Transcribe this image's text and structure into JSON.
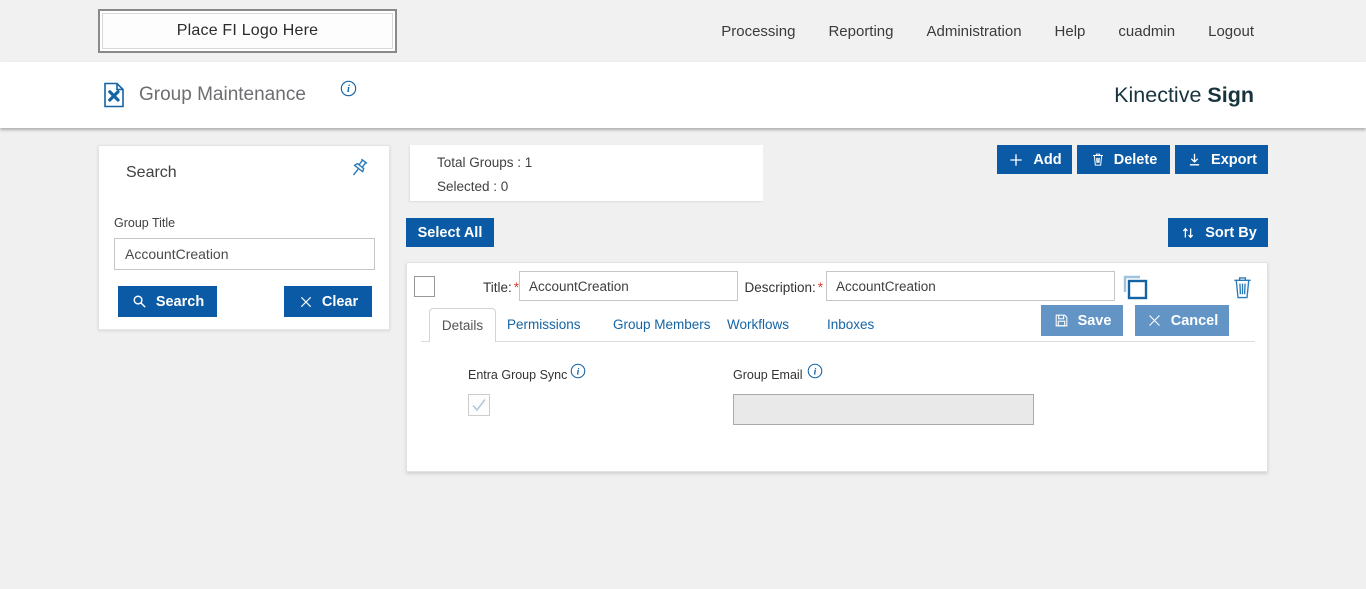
{
  "topbar": {
    "logo_placeholder": "Place FI Logo Here",
    "nav": [
      "Processing",
      "Reporting",
      "Administration",
      "Help",
      "cuadmin",
      "Logout"
    ]
  },
  "header": {
    "page_title": "Group Maintenance",
    "brand_name": "Kinective",
    "brand_product": "Sign"
  },
  "search_panel": {
    "title": "Search",
    "group_title_label": "Group Title",
    "group_title_value": "AccountCreation",
    "search_button": "Search",
    "clear_button": "Clear"
  },
  "summary": {
    "total_groups": "Total Groups : 1",
    "selected": "Selected : 0"
  },
  "toolbar": {
    "add": "Add",
    "delete": "Delete",
    "export": "Export",
    "select_all": "Select All",
    "sort_by": "Sort By"
  },
  "group_editor": {
    "title_label": "Title:",
    "description_label": "Description:",
    "required_mark": "*",
    "title_value": "AccountCreation",
    "description_value": "AccountCreation",
    "tabs": [
      "Details",
      "Permissions",
      "Group Members",
      "Workflows",
      "Inboxes"
    ],
    "active_tab": "Details",
    "save_button": "Save",
    "cancel_button": "Cancel",
    "details_tab": {
      "entra_group_sync_label": "Entra Group Sync",
      "entra_group_sync_checked": true,
      "group_email_label": "Group Email",
      "group_email_value": ""
    }
  },
  "icons": {
    "page_title_icon": "document-with-tools",
    "info_icon": "circled-italic-i",
    "pin_icon": "pushpin",
    "search_icon": "magnifier",
    "clear_icon": "x-cross",
    "add_icon": "plus",
    "delete_icon": "trash-can",
    "export_icon": "download-arrow",
    "sort_icon": "up-down-arrows",
    "save_icon": "floppy-disk",
    "cancel_icon": "x-cross",
    "copy_icon": "overlapping-squares",
    "check_icon": "checkmark"
  },
  "colors": {
    "primary_button": "#0b5aa5",
    "secondary_button": "#6295c6",
    "link_blue": "#1464a5",
    "icon_blue": "#2a7ab9",
    "brand_text": "#17333e",
    "topbar_background": "#f1f1f2",
    "page_background": "#f0f0f1",
    "required_red": "#e03c31"
  }
}
